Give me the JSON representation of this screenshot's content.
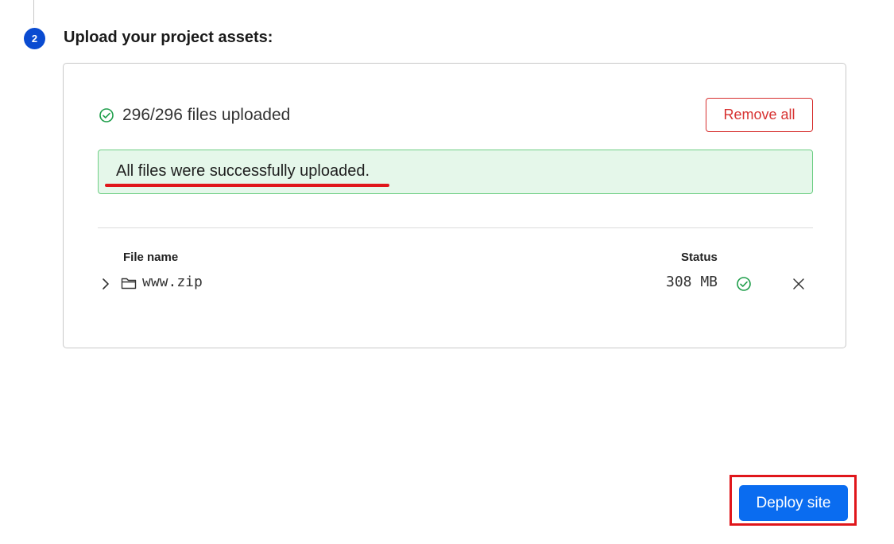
{
  "step": {
    "number": "2",
    "title": "Upload your project assets:"
  },
  "upload": {
    "count_text": "296/296 files uploaded",
    "remove_all_label": "Remove all",
    "success_message": "All files were successfully uploaded."
  },
  "table": {
    "columns": {
      "file_name": "File name",
      "status": "Status"
    },
    "rows": [
      {
        "name": "www.zip",
        "size": "308 MB",
        "status_icon": "check-circle-icon",
        "type_icon": "folder-icon"
      }
    ]
  },
  "actions": {
    "deploy_label": "Deploy site"
  },
  "colors": {
    "step_badge": "#0a4bd1",
    "success_bg": "#e5f7ea",
    "success_border": "#6fcf85",
    "success_icon": "#1e9e4a",
    "danger": "#d7302f",
    "primary": "#0a6cf0",
    "annotation": "#e0161b"
  }
}
